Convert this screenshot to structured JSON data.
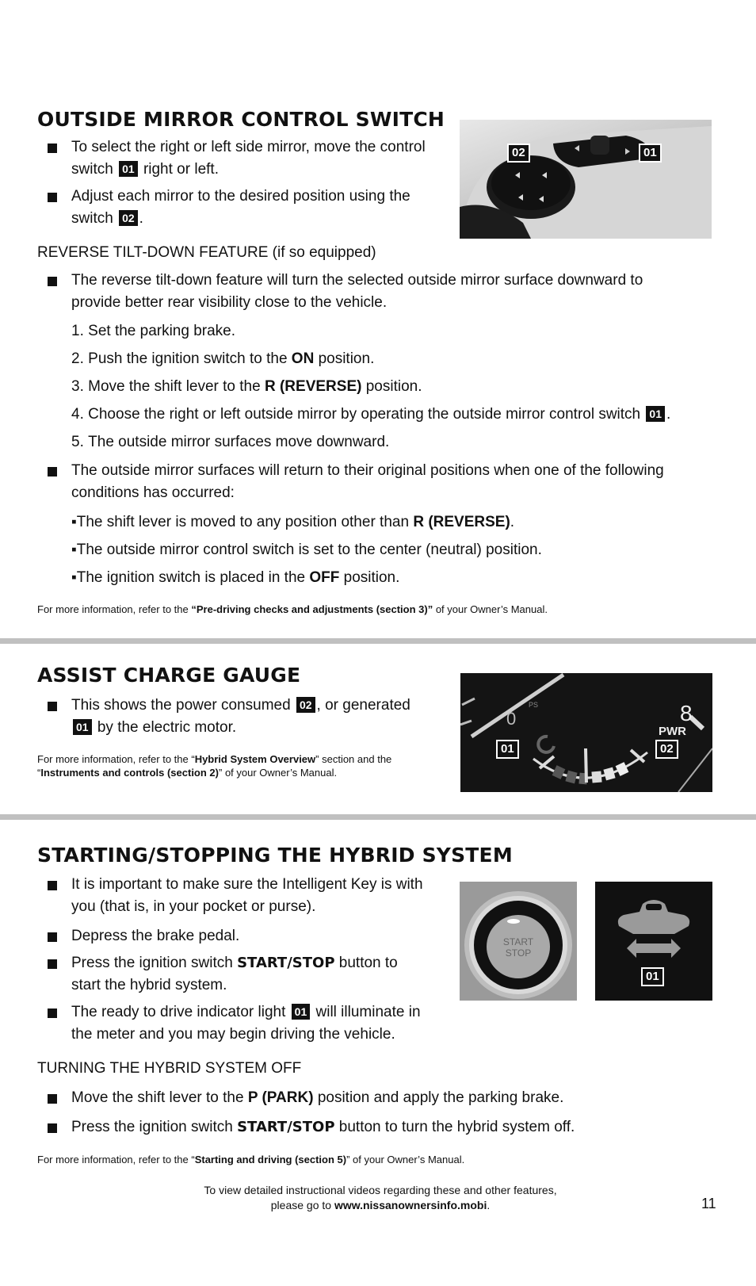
{
  "section1": {
    "title": "OUTSIDE MIRROR CONTROL SWITCH",
    "bullets": [
      {
        "before": "To select the right or left side mirror, move the control",
        "line2_before": "switch",
        "badge": "01",
        "after": "right or left."
      },
      {
        "before": "Adjust each mirror to the desired position using the",
        "line2_before": "switch",
        "badge": "02",
        "after": "."
      }
    ],
    "image_labels": [
      "02",
      "01"
    ],
    "subheading": "REVERSE TILT-DOWN FEATURE (if so equipped)",
    "tilt_bullet": "The reverse tilt-down feature will turn the selected outside mirror surface downward to provide better rear visibility close to the vehicle.",
    "steps": [
      {
        "n": "1.",
        "text": "Set the parking brake.",
        "bold": "",
        "after": ""
      },
      {
        "n": "2.",
        "text": "Push the ignition switch to the ",
        "bold": "ON",
        "after": " position."
      },
      {
        "n": "3.",
        "text": "Move the shift lever to the ",
        "bold": "R (REVERSE)",
        "after": " position."
      },
      {
        "n": "4.",
        "text": "Choose the right or left outside mirror by operating the outside mirror control switch",
        "badge": "01",
        "after": "."
      },
      {
        "n": "5.",
        "text": "The outside mirror surfaces move downward.",
        "bold": "",
        "after": ""
      }
    ],
    "return_bullet": "The outside mirror surfaces will return to their original positions when one of the following conditions has occurred:",
    "conditions": [
      {
        "text": "The shift lever is moved to any position other than ",
        "bold": "R (REVERSE)",
        "after": "."
      },
      {
        "text": "The outside mirror control switch is set to the center (neutral) position.",
        "bold": "",
        "after": ""
      },
      {
        "text": "The ignition switch is placed in the ",
        "bold": "OFF",
        "after": " position."
      }
    ],
    "reference": {
      "before": "For more information, refer to the ",
      "bold": "“Pre-driving checks and adjustments (section 3)”",
      "after": " of your Owner’s Manual."
    }
  },
  "section2": {
    "title": "ASSIST CHARGE GAUGE",
    "bullet": {
      "before": "This shows the power consumed",
      "badge1": "02",
      "mid": ", or generated",
      "badge2": "01",
      "after": "by the electric motor."
    },
    "reference": {
      "line1_before": "For more information, refer to the “",
      "line1_bold": "Hybrid System Overview",
      "line1_after": "” section and the",
      "line2_before": "“",
      "line2_bold": "Instruments and controls (section 2)",
      "line2_after": "” of your Owner’s Manual."
    },
    "image_labels": [
      "01",
      "02"
    ],
    "gauge_text": {
      "pwr": "PWR",
      "digit": "8",
      "ps": "PS"
    }
  },
  "section3": {
    "title": "STARTING/STOPPING THE HYBRID SYSTEM",
    "bullets": [
      {
        "l1": "It is important to make sure the Intelligent Key is with",
        "l2": "you (that is, in your pocket or purse)."
      },
      {
        "l1": "Depress the brake pedal.",
        "l2": ""
      },
      {
        "l1_before": "Press the ignition switch ",
        "l1_bold": "START/STOP",
        "l1_after": " button to",
        "l2": "start the hybrid system."
      },
      {
        "l1_before": "The ready to drive indicator light",
        "badge": "01",
        "l1_after": "will illuminate in",
        "l2": "the meter and you may begin driving the vehicle."
      }
    ],
    "button_text": [
      "START",
      "STOP"
    ],
    "image_label": "01",
    "subheading": "TURNING THE HYBRID SYSTEM OFF",
    "off_bullets": [
      {
        "before": "Move the shift lever to the ",
        "bold": "P (PARK)",
        "after": " position and apply the parking brake."
      },
      {
        "before": "Press the ignition switch ",
        "bold": "START/STOP",
        "after": " button to turn the hybrid system off."
      }
    ],
    "reference": {
      "before": "For more information, refer to the “",
      "bold": "Starting and driving (section 5)",
      "after": "” of your Owner’s Manual."
    }
  },
  "footer": {
    "line1": "To view detailed instructional videos regarding these and other features,",
    "line2_before": "please go to ",
    "line2_link": "www.nissanownersinfo.mobi",
    "line2_after": ".",
    "page_number": "11"
  }
}
